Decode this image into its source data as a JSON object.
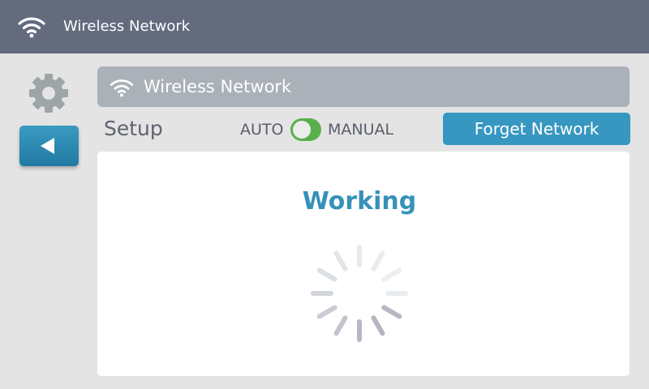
{
  "header": {
    "title": "Wireless Network",
    "icon": "wifi-icon"
  },
  "sidebar": {
    "settings_icon": "gear-icon",
    "back_icon": "back-arrow-icon"
  },
  "network_bar": {
    "name": "Wireless Network",
    "icon": "wifi-icon"
  },
  "setup": {
    "label": "Setup",
    "mode_left": "AUTO",
    "mode_right": "MANUAL",
    "mode_toggle_state": "AUTO",
    "forget_label": "Forget Network"
  },
  "status": {
    "message": "Working",
    "spinner_icon": "loading-spinner-icon"
  },
  "colors": {
    "header_bg": "#636b7d",
    "accent": "#3797c1",
    "toggle_on": "#58b04b",
    "working_text": "#3691b9",
    "background": "#e4e4e5"
  }
}
